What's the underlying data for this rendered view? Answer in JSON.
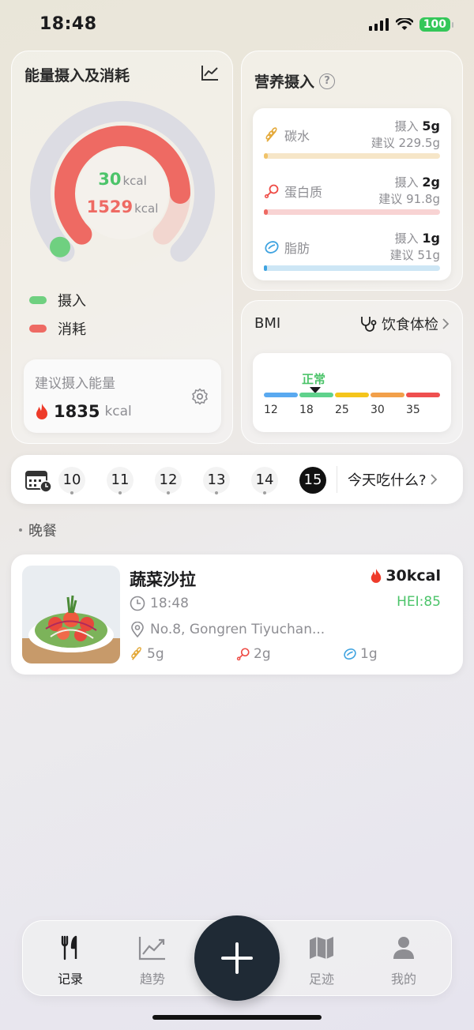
{
  "status_bar": {
    "time": "18:48",
    "battery": "100"
  },
  "energy": {
    "title": "能量摄入及消耗",
    "intake_value": "30",
    "intake_unit": "kcal",
    "burned_value": "1529",
    "burned_unit": "kcal",
    "legend_intake": "摄入",
    "legend_burned": "消耗",
    "suggest_label": "建议摄入能量",
    "suggest_value": "1835",
    "suggest_unit": "kcal",
    "colors": {
      "intake": "#4cc46a",
      "burned": "#ee6a63",
      "track": "#dcdce3"
    }
  },
  "nutrition": {
    "title": "营养摄入",
    "items": [
      {
        "name": "碳水",
        "intake_label": "摄入",
        "intake": "5g",
        "suggest_label": "建议",
        "suggest": "229.5g",
        "progress": 0.022,
        "color": "#f0c36a",
        "track": "#f6e6c8",
        "icon": "wheat-icon"
      },
      {
        "name": "蛋白质",
        "intake_label": "摄入",
        "intake": "2g",
        "suggest_label": "建议",
        "suggest": "91.8g",
        "progress": 0.022,
        "color": "#ee6a63",
        "track": "#f8d3d3",
        "icon": "drumstick-icon"
      },
      {
        "name": "脂肪",
        "intake_label": "摄入",
        "intake": "1g",
        "suggest_label": "建议",
        "suggest": "51g",
        "progress": 0.02,
        "color": "#3fa3e0",
        "track": "#cde6f5",
        "icon": "fat-drop-icon"
      }
    ]
  },
  "bmi": {
    "title": "BMI",
    "link": "饮食体检",
    "status": "正常",
    "ticks": [
      "12",
      "18",
      "25",
      "30",
      "35"
    ],
    "segment_colors": [
      "#5aa9f0",
      "#5fd28c",
      "#f5c51b",
      "#f2a04a",
      "#ef4f4f"
    ]
  },
  "dates": {
    "items": [
      "10",
      "11",
      "12",
      "13",
      "14",
      "15"
    ],
    "active": "15",
    "what_to_eat": "今天吃什么?"
  },
  "meal_section": {
    "label": "晚餐"
  },
  "meal": {
    "name": "蔬菜沙拉",
    "kcal": "30kcal",
    "hei": "HEI:85",
    "time": "18:48",
    "location": "No.8, Gongren Tiyuchan...",
    "carbs": "5g",
    "protein": "2g",
    "fat": "1g"
  },
  "tabs": [
    {
      "label": "记录",
      "icon": "fork-knife-icon",
      "active": true
    },
    {
      "label": "趋势",
      "icon": "trend-chart-icon",
      "active": false
    },
    {
      "label": "足迹",
      "icon": "map-icon",
      "active": false
    },
    {
      "label": "我的",
      "icon": "person-icon",
      "active": false
    }
  ],
  "fab_icon": "plus-icon"
}
